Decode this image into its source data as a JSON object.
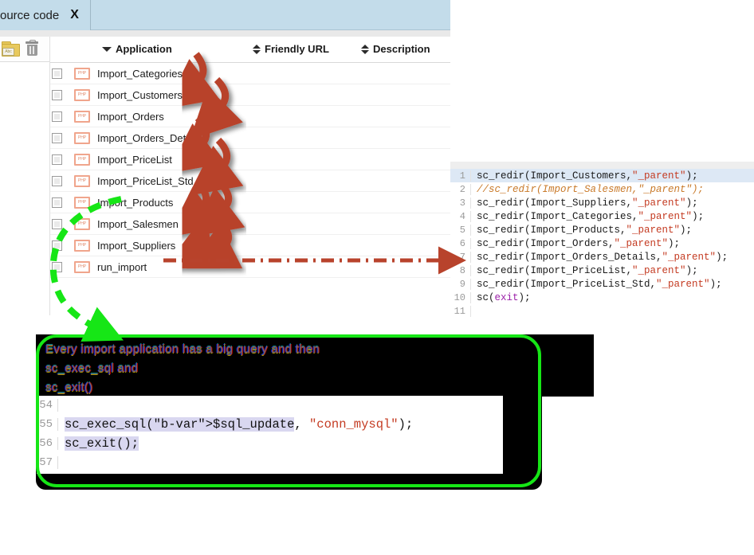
{
  "tab": {
    "label": "ource code",
    "close": "X"
  },
  "toolbar": {
    "icons": [
      {
        "name": "folder-abc-icon",
        "label": "Abc"
      },
      {
        "name": "delete-icon",
        "label": ""
      }
    ]
  },
  "grid": {
    "columns": [
      {
        "label": "Application",
        "sort": "down"
      },
      {
        "label": "Friendly URL",
        "sort": "both"
      },
      {
        "label": "Description",
        "sort": "both"
      }
    ],
    "rows": [
      {
        "name": "Import_Categories",
        "friendly_url": "",
        "description": ""
      },
      {
        "name": "Import_Customers",
        "friendly_url": "",
        "description": ""
      },
      {
        "name": "Import_Orders",
        "friendly_url": "",
        "description": ""
      },
      {
        "name": "Import_Orders_Details",
        "friendly_url": "",
        "description": ""
      },
      {
        "name": "Import_PriceList",
        "friendly_url": "",
        "description": ""
      },
      {
        "name": "Import_PriceList_Std",
        "friendly_url": "",
        "description": ""
      },
      {
        "name": "Import_Products",
        "friendly_url": "",
        "description": ""
      },
      {
        "name": "Import_Salesmen",
        "friendly_url": "",
        "description": ""
      },
      {
        "name": "Import_Suppliers",
        "friendly_url": "",
        "description": ""
      },
      {
        "name": "run_import",
        "friendly_url": "",
        "description": ""
      }
    ]
  },
  "code_right": {
    "lines": [
      {
        "num": "1",
        "code": "sc_redir(Import_Customers,\"_parent\");",
        "highlight": true
      },
      {
        "num": "2",
        "code": "//sc_redir(Import_Salesmen,\"_parent\");",
        "highlight": false
      },
      {
        "num": "3",
        "code": "sc_redir(Import_Suppliers,\"_parent\");",
        "highlight": false
      },
      {
        "num": "4",
        "code": "sc_redir(Import_Categories,\"_parent\");",
        "highlight": false
      },
      {
        "num": "5",
        "code": "sc_redir(Import_Products,\"_parent\");",
        "highlight": false
      },
      {
        "num": "6",
        "code": "sc_redir(Import_Orders,\"_parent\");",
        "highlight": false
      },
      {
        "num": "7",
        "code": "sc_redir(Import_Orders_Details,\"_parent\");",
        "highlight": false
      },
      {
        "num": "8",
        "code": "sc_redir(Import_PriceList,\"_parent\");",
        "highlight": false
      },
      {
        "num": "9",
        "code": "sc_redir(Import_PriceList_Std,\"_parent\");",
        "highlight": false
      },
      {
        "num": "10",
        "code": "sc(exit);",
        "highlight": false
      },
      {
        "num": "11",
        "code": "",
        "highlight": false
      }
    ]
  },
  "annotation": {
    "note": "Every import application has a big query and then\nsc_exec_sql and\nsc_exit()"
  },
  "code_bottom": {
    "lines": [
      {
        "num": "54",
        "code": ""
      },
      {
        "num": "55",
        "code": "sc_exec_sql($sql_update, \"conn_mysql\");"
      },
      {
        "num": "56",
        "code": "sc_exit();"
      },
      {
        "num": "57",
        "code": ""
      }
    ]
  },
  "colors": {
    "tabbar": "#c3dcea",
    "arrow_red": "#b8432c",
    "arrow_green": "#16e616",
    "php_icon": "#f0a58c",
    "selection": "#d9d7f0",
    "line_highlight": "#dde8f5"
  }
}
